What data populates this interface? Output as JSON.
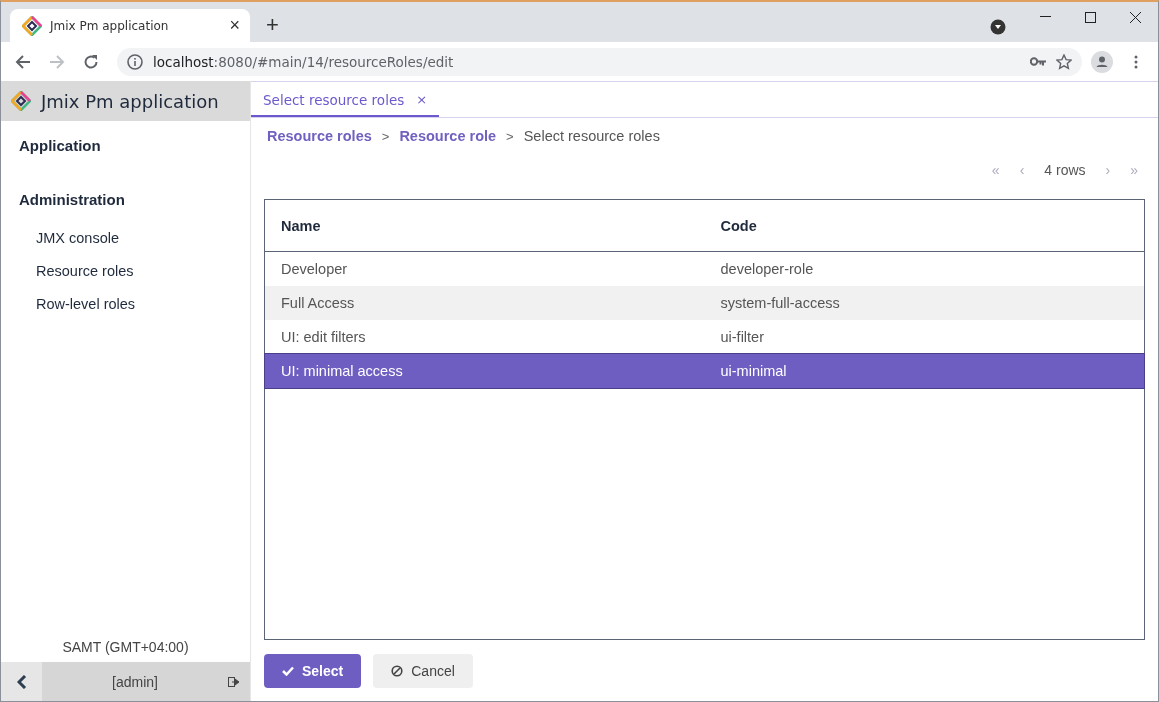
{
  "browser": {
    "tab_title": "Jmix Pm application",
    "tab_close": "×",
    "new_tab": "+",
    "url_host": "localhost",
    "url_path": ":8080/#main/14/resourceRoles/edit",
    "forward_disabled": true
  },
  "sidebar": {
    "app_title": "Jmix Pm application",
    "menu": [
      {
        "label": "Application"
      },
      {
        "label": "Administration",
        "children": [
          {
            "label": "JMX console"
          },
          {
            "label": "Resource roles"
          },
          {
            "label": "Row-level roles"
          }
        ]
      }
    ],
    "timezone": "SAMT (GMT+04:00)",
    "user": "[admin]"
  },
  "main": {
    "tabs": [
      {
        "label": "Select resource roles",
        "close": "×",
        "selected": true
      }
    ],
    "breadcrumbs": [
      {
        "label": "Resource roles",
        "kind": "link"
      },
      {
        "label": ">",
        "kind": "separator"
      },
      {
        "label": "Resource role",
        "kind": "link"
      },
      {
        "label": ">",
        "kind": "separator"
      },
      {
        "label": "Select resource roles",
        "kind": "current"
      }
    ],
    "pagination": {
      "first": "«",
      "prev": "‹",
      "count": "4 rows",
      "next": "›",
      "last": "»"
    },
    "table": {
      "columns": [
        "Name",
        "Code"
      ],
      "rows": [
        {
          "cells": [
            "Developer",
            "developer-role"
          ],
          "selected": false
        },
        {
          "cells": [
            "Full Access",
            "system-full-access"
          ],
          "selected": false
        },
        {
          "cells": [
            "UI: edit filters",
            "ui-filter"
          ],
          "selected": false
        },
        {
          "cells": [
            "UI: minimal access",
            "ui-minimal"
          ],
          "selected": true
        }
      ]
    },
    "buttons": [
      {
        "label": "Select",
        "kind": "primary"
      },
      {
        "label": "Cancel",
        "kind": "secondary"
      }
    ]
  }
}
